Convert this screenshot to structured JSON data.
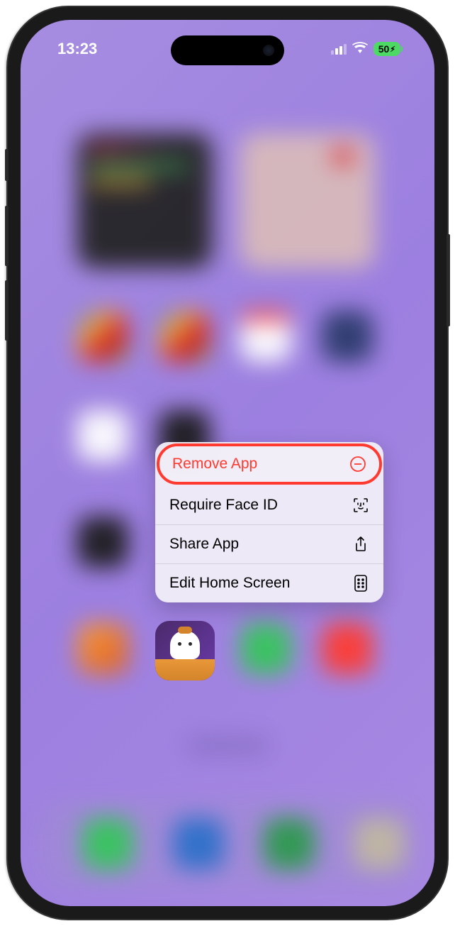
{
  "status": {
    "time": "13:23",
    "battery": "50"
  },
  "menu": {
    "items": [
      {
        "label": "Remove App",
        "icon": "minus-circle",
        "destructive": true
      },
      {
        "label": "Require Face ID",
        "icon": "faceid"
      },
      {
        "label": "Share App",
        "icon": "share"
      },
      {
        "label": "Edit Home Screen",
        "icon": "apps"
      }
    ]
  }
}
